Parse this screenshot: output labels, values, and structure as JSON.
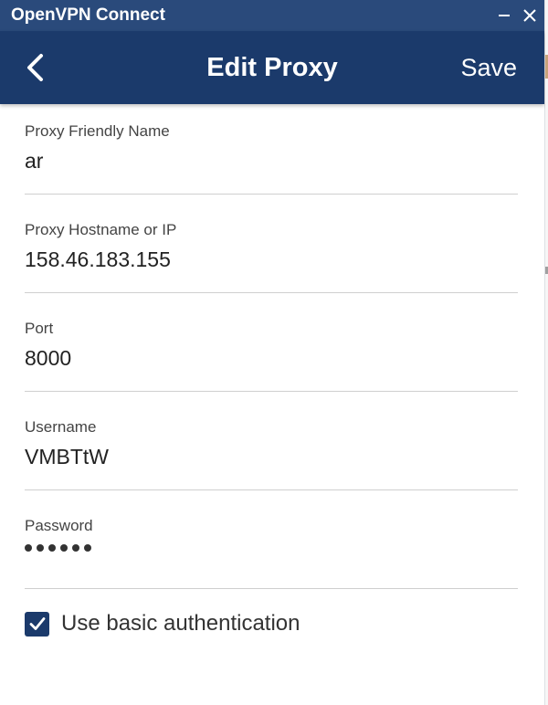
{
  "window": {
    "title": "OpenVPN Connect"
  },
  "header": {
    "title": "Edit Proxy",
    "save_label": "Save"
  },
  "fields": {
    "friendly_name": {
      "label": "Proxy Friendly Name",
      "value": "ar"
    },
    "hostname": {
      "label": "Proxy Hostname or IP",
      "value": "158.46.183.155"
    },
    "port": {
      "label": "Port",
      "value": "8000"
    },
    "username": {
      "label": "Username",
      "value": "VMBTtW"
    },
    "password": {
      "label": "Password",
      "masked_length": 6
    }
  },
  "auth": {
    "label": "Use basic authentication",
    "checked": true
  },
  "colors": {
    "titlebar": "#2a4a7b",
    "header": "#1b3a6b",
    "checkbox": "#1b3a6b"
  },
  "icons": {
    "back": "chevron-left-icon",
    "minimize": "minimize-icon",
    "close": "close-icon",
    "check": "check-icon"
  }
}
